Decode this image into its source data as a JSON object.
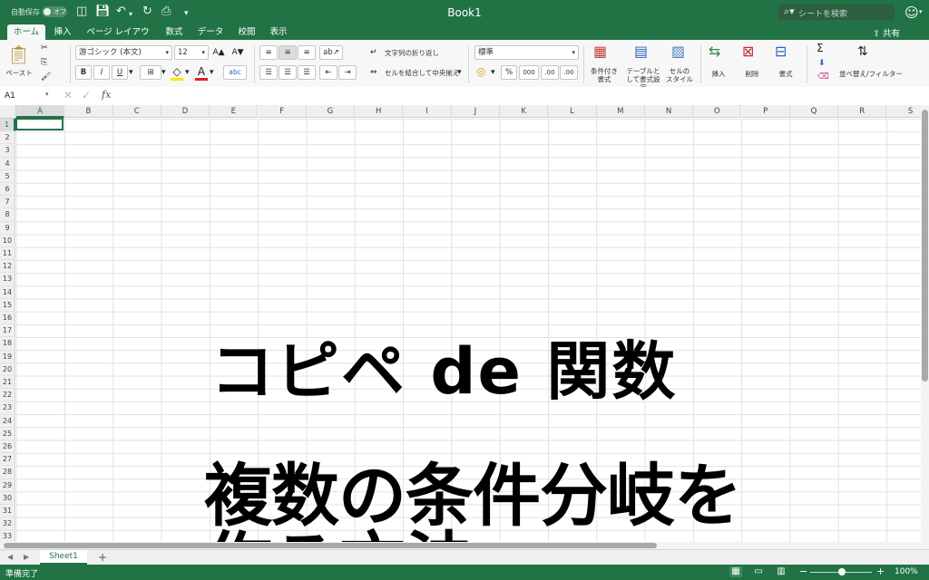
{
  "titlebar": {
    "autosave_label": "自動保存",
    "autosave_state": "オフ",
    "doc_title": "Book1",
    "search_placeholder": "シートを検索"
  },
  "tabs": [
    "ホーム",
    "挿入",
    "ページ レイアウト",
    "数式",
    "データ",
    "校閲",
    "表示"
  ],
  "share_label": "共有",
  "ribbon": {
    "paste_label": "ペースト",
    "font_name": "游ゴシック (本文)",
    "font_size": "12",
    "bold": "B",
    "italic": "I",
    "underline": "U",
    "font_grow": "A▲",
    "font_shrink": "A▼",
    "font_color_glyph": "A",
    "phonetic_glyph": "abc",
    "wrap_text_label": "文字列の折り返し",
    "merge_center_label": "セルを結合して中央揃え",
    "number_format": "標準",
    "percent": "%",
    "comma": "000",
    "inc_decimal": ".00",
    "dec_decimal": ".00",
    "conditional_format_label": [
      "条件付き",
      "書式"
    ],
    "table_format_label": [
      "テーブルと",
      "して書式設定"
    ],
    "cell_style_label": [
      "セルの",
      "スタイル"
    ],
    "insert_label": "挿入",
    "delete_label": "削除",
    "format_label": "書式",
    "sort_filter_label": "並べ替え/フィルター"
  },
  "formula_bar": {
    "name_box": "A1",
    "fx": "fx"
  },
  "grid": {
    "columns": [
      "A",
      "B",
      "C",
      "D",
      "E",
      "F",
      "G",
      "H",
      "I",
      "J",
      "K",
      "L",
      "M",
      "N",
      "O",
      "P",
      "Q",
      "R",
      "S"
    ],
    "rows": [
      "1",
      "2",
      "3",
      "4",
      "5",
      "6",
      "7",
      "8",
      "9",
      "10",
      "11",
      "12",
      "13",
      "14",
      "15",
      "16",
      "17",
      "18",
      "19",
      "20",
      "21",
      "22",
      "23",
      "24",
      "25",
      "26",
      "27",
      "28",
      "29",
      "30",
      "31",
      "32",
      "33"
    ],
    "selected_cell": "A1"
  },
  "overlay": {
    "line1": "コピペ de 関数",
    "line2": "複数の条件分岐を",
    "line3": "作る方法"
  },
  "sheet_tab": "Sheet1",
  "status": {
    "text": "準備完了",
    "zoom": "100%"
  },
  "colors": {
    "brand_green": "#217346"
  }
}
